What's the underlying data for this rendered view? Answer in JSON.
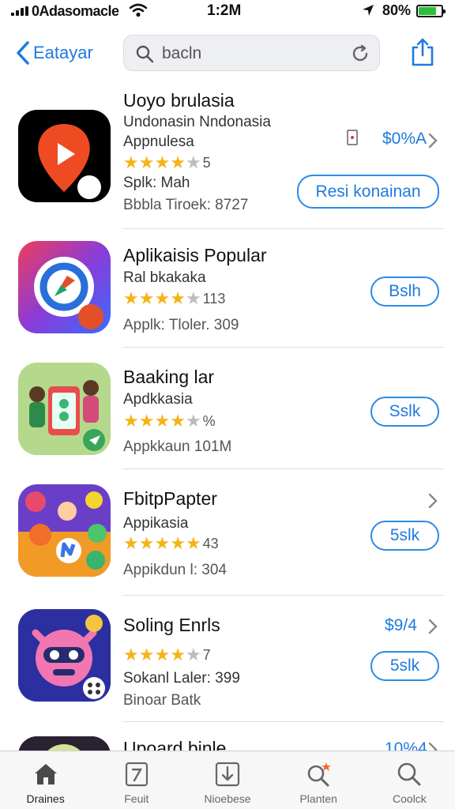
{
  "status_bar": {
    "carrier": "0Adasomacle",
    "time": "1:2M",
    "battery": "80%",
    "battery_level": 0.8,
    "icons": [
      "signal-icon",
      "wifi-icon",
      "location-arrow-icon",
      "battery-icon"
    ]
  },
  "nav": {
    "back_label": "Eatayar",
    "search_value": "bacln",
    "icons": [
      "chevron-left-icon",
      "search-icon",
      "reload-icon",
      "share-icon"
    ]
  },
  "apps": [
    {
      "title": "Uoyo brulasia",
      "lines": [
        "Undonasin Nndonasia",
        "Appnulesa"
      ],
      "stars": 4,
      "rating_count": "5",
      "meta": [
        "Splk: Mah",
        "Bbbla Tiroek: 8727"
      ],
      "button_label": "Resi konainan",
      "price": "$0%A"
    },
    {
      "title": "Aplikaisis Popular",
      "lines": [
        "Ral bkakaka"
      ],
      "stars": 4,
      "rating_count": "113",
      "meta": [
        "Applk: Tloler. 309"
      ],
      "button_label": "Bslh"
    },
    {
      "title": "Baaking lar",
      "lines": [
        "Apdkkasia"
      ],
      "stars": 4,
      "rating_count": "%",
      "meta": [
        "Appkkaun 101M"
      ],
      "button_label": "Sslk"
    },
    {
      "title": "FbitpPapter",
      "lines": [
        "Appikasia"
      ],
      "stars": 5,
      "rating_count": "43",
      "meta": [
        "Appikdun l: 304"
      ],
      "button_label": "5slk"
    },
    {
      "title": "Soling Enrls",
      "lines": [],
      "stars": 4,
      "rating_count": "7",
      "meta": [
        "Sokanl Laler: 399",
        "Binoar Batk"
      ],
      "button_label": "5slk",
      "price": "$9/4"
    },
    {
      "title": "Upoard binle",
      "price": "10%4"
    }
  ],
  "tabs": [
    {
      "label": "Draines",
      "icon": "home-icon"
    },
    {
      "label": "Feuit",
      "icon": "document-icon"
    },
    {
      "label": "Nioebese",
      "icon": "download-icon"
    },
    {
      "label": "Planten",
      "icon": "search-star-icon"
    },
    {
      "label": "Coolck",
      "icon": "search-icon"
    }
  ],
  "colors": {
    "accent": "#1f7ae0",
    "star": "#f5b319",
    "battery": "#2bbf3a"
  }
}
